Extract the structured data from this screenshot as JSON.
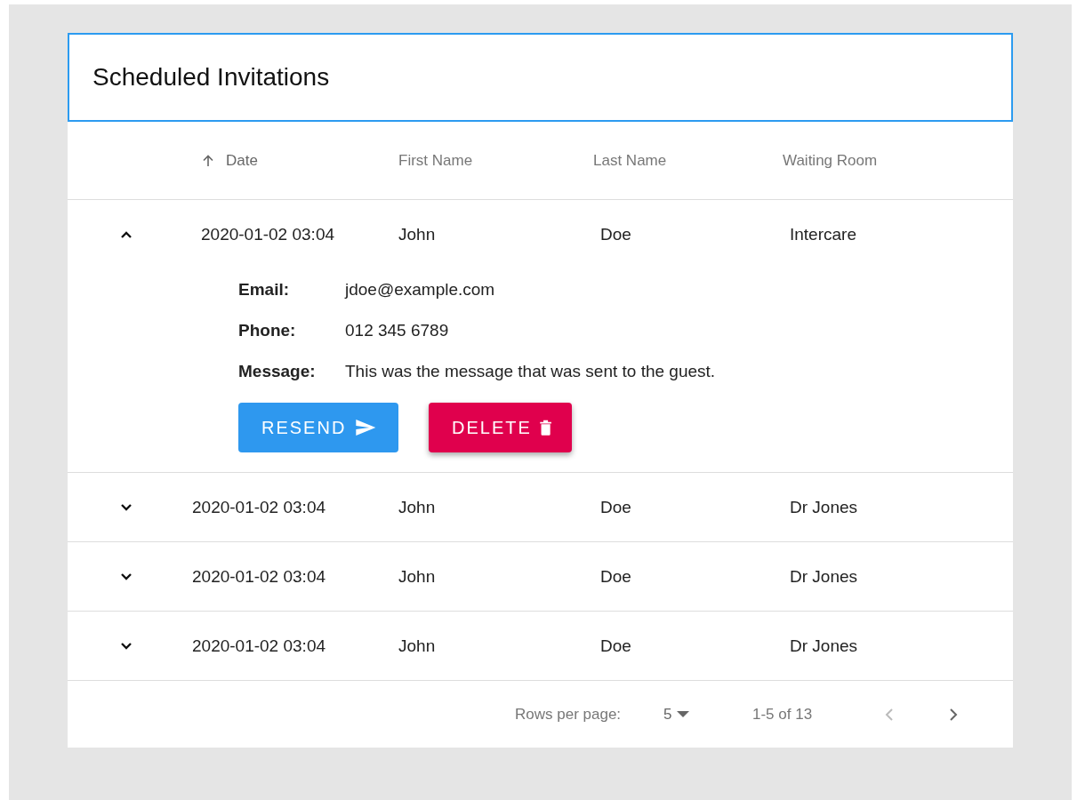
{
  "title": "Scheduled Invitations",
  "columns": [
    {
      "label": "Date",
      "sorted": true
    },
    {
      "label": "First Name",
      "sorted": false
    },
    {
      "label": "Last Name",
      "sorted": false
    },
    {
      "label": "Waiting Room",
      "sorted": false
    }
  ],
  "rows": [
    {
      "expanded": true,
      "date": "2020-01-02 03:04",
      "first_name": "John",
      "last_name": "Doe",
      "waiting_room": "Intercare",
      "details": [
        {
          "label": "Email:",
          "value": "jdoe@example.com"
        },
        {
          "label": "Phone:",
          "value": "012 345 6789"
        },
        {
          "label": "Message:",
          "value": "This was the message that was sent to the guest."
        }
      ],
      "actions": [
        {
          "label": "RESEND",
          "kind": "resend"
        },
        {
          "label": "DELETE",
          "kind": "delete"
        }
      ]
    },
    {
      "expanded": false,
      "date": "2020-01-02 03:04",
      "first_name": "John",
      "last_name": "Doe",
      "waiting_room": "Dr Jones"
    },
    {
      "expanded": false,
      "date": "2020-01-02 03:04",
      "first_name": "John",
      "last_name": "Doe",
      "waiting_room": "Dr Jones"
    },
    {
      "expanded": false,
      "date": "2020-01-02 03:04",
      "first_name": "John",
      "last_name": "Doe",
      "waiting_room": "Dr Jones"
    }
  ],
  "pagination": {
    "rows_per_page_label": "Rows per page:",
    "rows_per_page": "5",
    "range": "1-5 of 13",
    "prev_disabled": true,
    "next_disabled": false
  }
}
